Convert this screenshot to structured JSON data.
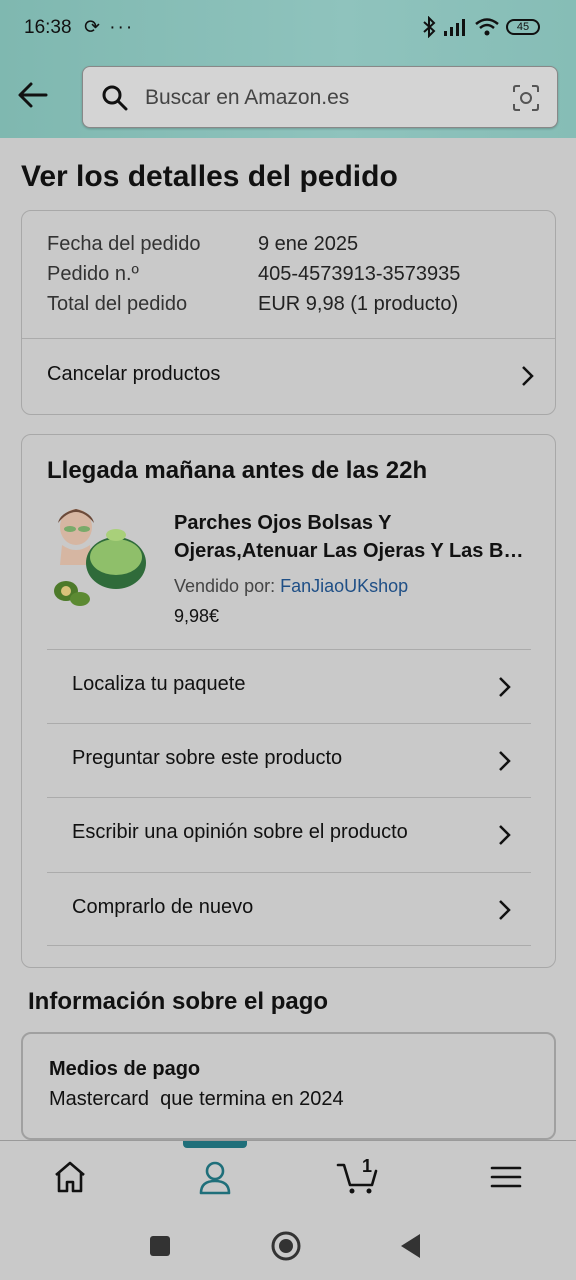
{
  "status_bar": {
    "time": "16:38",
    "left_icons": "⟳ ···",
    "battery": "45"
  },
  "search": {
    "placeholder": "Buscar en Amazon.es"
  },
  "page": {
    "title": "Ver los detalles del pedido"
  },
  "order_summary": {
    "rows": [
      {
        "label": "Fecha del pedido",
        "value": "9 ene 2025"
      },
      {
        "label": "Pedido n.º",
        "value": "405-4573913-3573935"
      },
      {
        "label": "Total del pedido",
        "value": "EUR 9,98 (1 producto)"
      }
    ],
    "cancel_label": "Cancelar productos"
  },
  "delivery": {
    "title": "Llegada mañana antes de las 22h",
    "product": {
      "title_line1": "Parches Ojos Bolsas Y",
      "title_line2": "Ojeras,Atenuar Las Ojeras Y Las Bolsas",
      "seller_prefix": "Vendido por:",
      "seller_name": "FanJiaoUKshop",
      "price": "9,98€"
    },
    "actions": [
      {
        "label": "Localiza tu paquete"
      },
      {
        "label": "Preguntar sobre este producto"
      },
      {
        "label": "Escribir una opinión sobre el producto"
      },
      {
        "label": "Comprarlo de nuevo"
      }
    ]
  },
  "payment": {
    "section_title": "Información sobre el pago",
    "method_title": "Medios de pago",
    "method_value": "Mastercard  que termina en 2024"
  },
  "bottom_nav": {
    "cart_count": "1",
    "items": [
      "home-icon",
      "account-icon",
      "cart-icon",
      "menu-icon"
    ],
    "active": "account-icon"
  },
  "colors": {
    "header_teal": "#86bdb6",
    "link_blue": "#1f4f86",
    "active_nav": "#1f6f7a"
  }
}
